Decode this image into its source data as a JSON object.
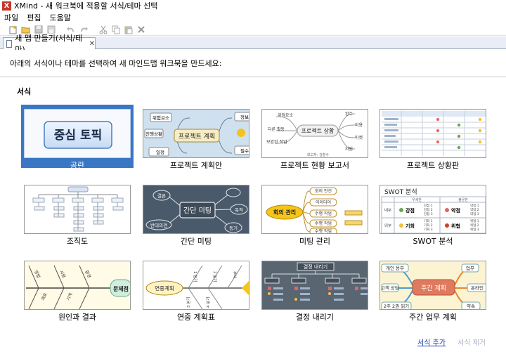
{
  "window": {
    "app_icon": "X",
    "title": "XMind - 새 워크북에 적용할 서식/테마 선택"
  },
  "menu": [
    "파일",
    "편집",
    "도움말"
  ],
  "toolbar_icons": [
    "new-workbook-icon",
    "open-icon",
    "save-icon",
    "save-as-icon",
    "undo-icon",
    "redo-icon",
    "cut-icon",
    "copy-icon",
    "paste-icon",
    "delete-icon"
  ],
  "tab": {
    "label": "새 맵 만들기(서식/테마)",
    "close": "✕"
  },
  "instruction": "아래의 서식이나 테마를 선택하여 새 마인드맵 워크북을 만드세요:",
  "section_label": "서식",
  "templates": [
    {
      "caption": "공란",
      "selected": true,
      "center_topic": "중심 토픽"
    },
    {
      "caption": "프로젝트 계획안",
      "selected": false,
      "center_topic": "프로젝트 계획",
      "nodes": [
        "위험요소",
        "진행상황",
        "일정",
        "정보",
        "필수"
      ]
    },
    {
      "caption": "프로젝트 현황 보고서",
      "selected": false,
      "center_topic": "프로젝트 상황",
      "nodes": [
        "위험요소",
        "다른 활동",
        "보완된 작업",
        "완수",
        "비용",
        "마켓",
        "자원"
      ],
      "footer": "보고자: 김철수"
    },
    {
      "caption": "프로젝트 상황판",
      "selected": false
    },
    {
      "caption": "조직도",
      "selected": false
    },
    {
      "caption": "간단 미팅",
      "selected": false,
      "center_topic": "간단 미팅",
      "nodes": [
        "결론",
        "반대의견",
        "목적",
        "동기"
      ]
    },
    {
      "caption": "미팅 관리",
      "selected": false,
      "center_topic": "회의 관리",
      "nodes": [
        "회의 안건",
        "아이디어",
        "수행 작업",
        "수행 작업",
        "수행 작업"
      ]
    },
    {
      "caption": "SWOT 분석",
      "selected": false,
      "center_topic": "SWOT 분석",
      "columns": [
        "우세한",
        "불운한"
      ],
      "rows": [
        "내부",
        "외부"
      ],
      "cells": [
        "강점",
        "약점",
        "기회",
        "위협"
      ],
      "items": [
        "강점 1",
        "강점 2",
        "강점 3",
        "약점 1",
        "약점 2",
        "약점 3",
        "기회 1",
        "기회 2",
        "기회 3",
        "위협 1",
        "위협 2",
        "위협 3"
      ]
    },
    {
      "caption": "원인과 결과",
      "selected": false,
      "center_topic": "문제점",
      "nodes": [
        "방법",
        "사람",
        "환경",
        "측정",
        "재료",
        "기계"
      ]
    },
    {
      "caption": "연중 계획표",
      "selected": false,
      "center_topic": "연중계획",
      "nodes": [
        "1 분기",
        "2 분기",
        "3 분기",
        "4 분기",
        "부서"
      ]
    },
    {
      "caption": "결정 내리기",
      "selected": false,
      "center_topic": "결정 내리기"
    },
    {
      "caption": "주간 업무 계획",
      "selected": false,
      "center_topic": "주간 계획",
      "nodes": [
        "개인 용무",
        "고객 상담",
        "2주 2권 읽기",
        "업무",
        "온라인",
        "약속"
      ]
    }
  ],
  "links": {
    "add": "서식 추가",
    "delete": "서식 제거"
  }
}
